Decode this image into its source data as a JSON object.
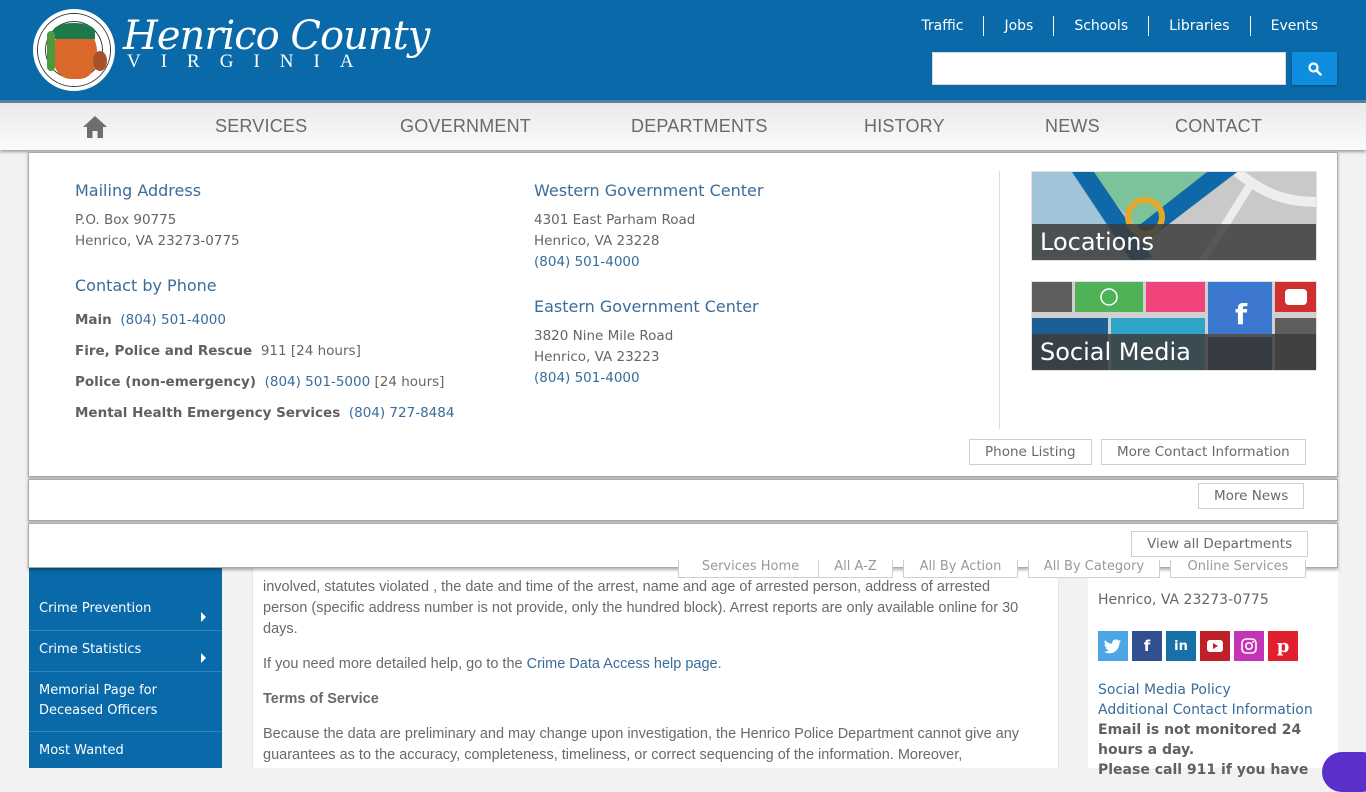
{
  "header": {
    "brand_title": "Henrico County",
    "brand_subtitle": "VIRGINIA",
    "logo_alt": "County of Henrico Virginia seal",
    "top_links": [
      "Traffic",
      "Jobs",
      "Schools",
      "Libraries",
      "Events"
    ],
    "search": {
      "value": "",
      "placeholder": ""
    }
  },
  "nav": {
    "home_icon": "home-icon",
    "items": [
      "SERVICES",
      "GOVERNMENT",
      "DEPARTMENTS",
      "HISTORY",
      "NEWS",
      "CONTACT"
    ]
  },
  "contact_panel": {
    "mailing": {
      "heading": "Mailing Address",
      "line1": "P.O. Box 90775",
      "line2": "Henrico, VA 23273-0775"
    },
    "phone": {
      "heading": "Contact by Phone",
      "rows": [
        {
          "label": "Main",
          "value": "(804) 501-4000",
          "suffix": ""
        },
        {
          "label": "Fire, Police and Rescue",
          "value": "",
          "suffix": "911 [24 hours]"
        },
        {
          "label": "Police (non-emergency)",
          "value": "(804) 501-5000",
          "suffix": "[24 hours]"
        },
        {
          "label": "Mental Health Emergency Services",
          "value": "(804) 727-8484",
          "suffix": ""
        }
      ]
    },
    "western": {
      "heading": "Western Government Center",
      "line1": "4301 East Parham Road",
      "line2": "Henrico, VA 23228",
      "phone": "(804) 501-4000"
    },
    "eastern": {
      "heading": "Eastern Government Center",
      "line1": "3820 Nine Mile Road",
      "line2": "Henrico, VA 23223",
      "phone": "(804) 501-4000"
    },
    "tiles": {
      "locations": "Locations",
      "social": "Social Media"
    },
    "buttons": {
      "phone_listing": "Phone Listing",
      "more_contact": "More Contact Information"
    }
  },
  "news_panel": {
    "more_news": "More News"
  },
  "departments_panel": {
    "view_all": "View all Departments"
  },
  "services_buttons": [
    "Services Home",
    "All A-Z",
    "All By Action",
    "All By Category",
    "Online Services"
  ],
  "sidebar": {
    "items": [
      {
        "label": "Crime Prevention",
        "has_arrow": true
      },
      {
        "label": "Crime Statistics",
        "has_arrow": true
      },
      {
        "label": "Memorial Page for Deceased Officers",
        "has_arrow": false
      },
      {
        "label": "Most Wanted",
        "has_arrow": false
      }
    ]
  },
  "content": {
    "p0": "involved, statutes violated , the date and time of the arrest, name and age of arrested person, address of arrested",
    "p1": "person (specific address number is not provide, only the hundred block). Arrest reports are only available online for 30 days.",
    "p2_pre": "If you need more detailed help, go to the ",
    "p2_link": "Crime Data Access help page",
    "p2_post": ".",
    "terms_heading": "Terms of Service",
    "p3": "Because the data are preliminary and may change upon investigation, the Henrico Police Department cannot give any guarantees as to the accuracy, completeness, timeliness, or correct sequencing of the information. Moreover,"
  },
  "right_column": {
    "address_line": "Henrico, VA 23273-0775",
    "social_icons": [
      "twitter-icon",
      "facebook-icon",
      "linkedin-icon",
      "youtube-icon",
      "instagram-icon",
      "pinterest-icon"
    ],
    "social_policy": "Social Media Policy",
    "additional_contact": "Additional Contact Information",
    "email_notice": "Email is not monitored 24 hours a day.",
    "call_notice": "Please call 911 if you have"
  },
  "colors": {
    "brand_blue": "#0969a9",
    "link_blue": "#3a6c9c",
    "search_button": "#0f8ee0"
  }
}
